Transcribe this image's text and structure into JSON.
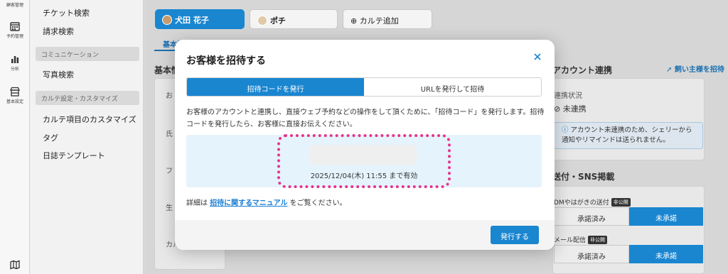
{
  "rail": {
    "items": [
      {
        "label": "顧客管理",
        "icon": "customer-icon"
      },
      {
        "label": "予約管理",
        "icon": "calendar-icon"
      },
      {
        "label": "分析",
        "icon": "bar-chart-icon"
      },
      {
        "label": "基本設定",
        "icon": "store-icon"
      },
      {
        "label": "",
        "icon": "map-icon"
      }
    ]
  },
  "sidebar": {
    "links": [
      "チケット検索",
      "請求検索",
      "写真検索",
      "カルテ項目のカスタマイズ",
      "タグ",
      "日誌テンプレート"
    ],
    "heads": [
      "コミュニケーション",
      "カルテ設定・カスタマイズ"
    ]
  },
  "main": {
    "pets": [
      {
        "name": "犬田 花子",
        "active": true
      },
      {
        "name": "ポチ",
        "active": false
      }
    ],
    "add_karte": "カルテ追加",
    "tab_basic": "基本情",
    "section_basic": "基本情",
    "labels": [
      "お",
      "氏",
      "フ",
      "生",
      "カル"
    ],
    "account_link": {
      "title": "アカウント連携",
      "invite_link": "飼い主様を招待",
      "status_label": "連携状況",
      "status_value": "未連携",
      "notice": "アカウント未連携のため、シェリーから通知やリマインドは送られません。"
    },
    "sns": {
      "title": "送付・SNS掲載",
      "row1_label": "DMやはがきの送付",
      "row1_badge": "非公開",
      "row2_label": "メール配信",
      "row2_badge": "非公開",
      "approved": "承諾済み",
      "not_approved": "未承諾"
    }
  },
  "modal": {
    "title": "お客様を招待する",
    "tabs": [
      "招待コードを発行",
      "URLを発行して招待"
    ],
    "active_tab": 0,
    "description": "お客様のアカウントと連携し、直接ウェブ予約などの操作をして頂くために、「招待コード」を発行します。招待コードを発行したら、お客様に直接お伝えください。",
    "code_value": "",
    "expires": "2025/12/04(木) 11:55 まで有効",
    "manual_prefix": "詳細は ",
    "manual_link": "招待に関するマニュアル",
    "manual_suffix": " をご覧ください。",
    "issue_button": "発行する"
  },
  "colors": {
    "accent": "#1a86d0",
    "highlight": "#e8328a",
    "code_bg": "#e5f3fc"
  }
}
